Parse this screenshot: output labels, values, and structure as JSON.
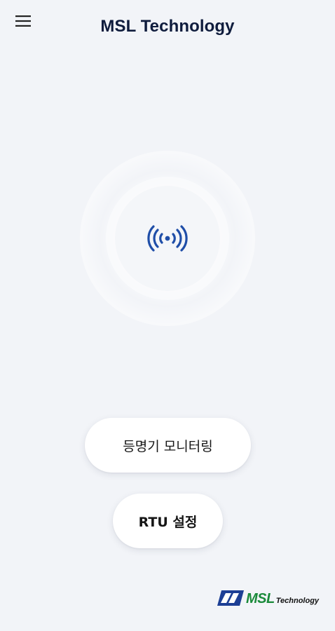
{
  "header": {
    "title": "MSL Technology",
    "menu_icon": "hamburger-menu-icon"
  },
  "nfc": {
    "icon": "nfc-wireless-signal-icon",
    "icon_color": "#1f4ea8"
  },
  "actions": {
    "monitor_label": "등명기 모니터링",
    "rtu_label": "RTU 설정"
  },
  "footer": {
    "logo_msl": "MSL",
    "logo_tech": "Technology",
    "logo_mark_color": "#1d3f95",
    "logo_msl_color": "#1a8a3a"
  },
  "colors": {
    "background": "#f2f4f8",
    "title": "#0f1c3d",
    "button_bg": "#ffffff"
  }
}
